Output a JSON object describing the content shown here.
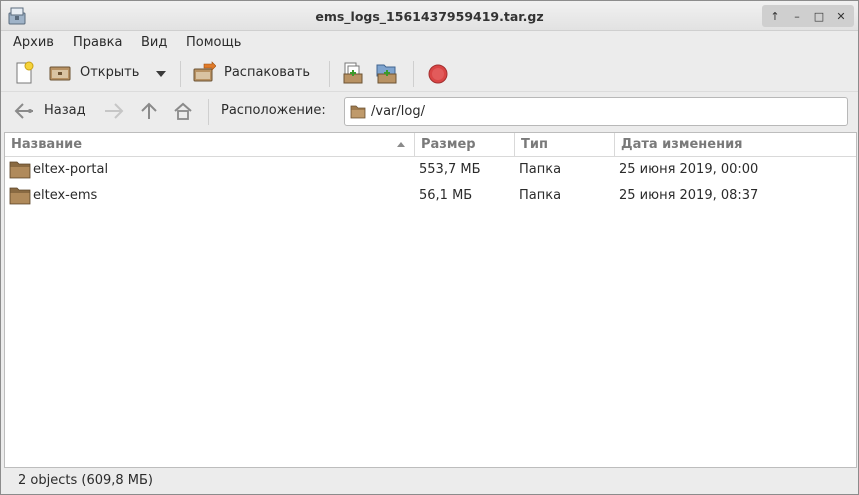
{
  "window": {
    "title": "ems_logs_1561437959419.tar.gz",
    "controls": {
      "up": "↑",
      "minimize": "–",
      "maximize": "□",
      "close": "✕"
    }
  },
  "menu": {
    "items": [
      {
        "label": "Архив"
      },
      {
        "label": "Правка"
      },
      {
        "label": "Вид"
      },
      {
        "label": "Помощь"
      }
    ]
  },
  "toolbar": {
    "new_icon": "new-archive-icon",
    "open_label": "Открыть",
    "open_icon": "open-archive-icon",
    "extract_label": "Распаковать",
    "extract_icon": "extract-icon",
    "add_files_icon": "add-files-icon",
    "add_folder_icon": "add-folder-icon",
    "stop_icon": "stop-icon"
  },
  "navigation": {
    "back_label": "Назад",
    "location_label": "Расположение:",
    "location_value": "/var/log/"
  },
  "file_list": {
    "columns": [
      {
        "label": "Название"
      },
      {
        "label": "Размер"
      },
      {
        "label": "Тип"
      },
      {
        "label": "Дата изменения"
      }
    ],
    "rows": [
      {
        "name": "eltex-portal",
        "size": "553,7 МБ",
        "type": "Папка",
        "modified": "25 июня 2019, 00:00"
      },
      {
        "name": "eltex-ems",
        "size": "56,1 МБ",
        "type": "Папка",
        "modified": "25 июня 2019, 08:37"
      }
    ]
  },
  "status": {
    "text": "2 objects (609,8 МБ)"
  },
  "colors": {
    "folder": "#a07c4f",
    "stop": "#d94545",
    "accent": "#d9a52f"
  }
}
